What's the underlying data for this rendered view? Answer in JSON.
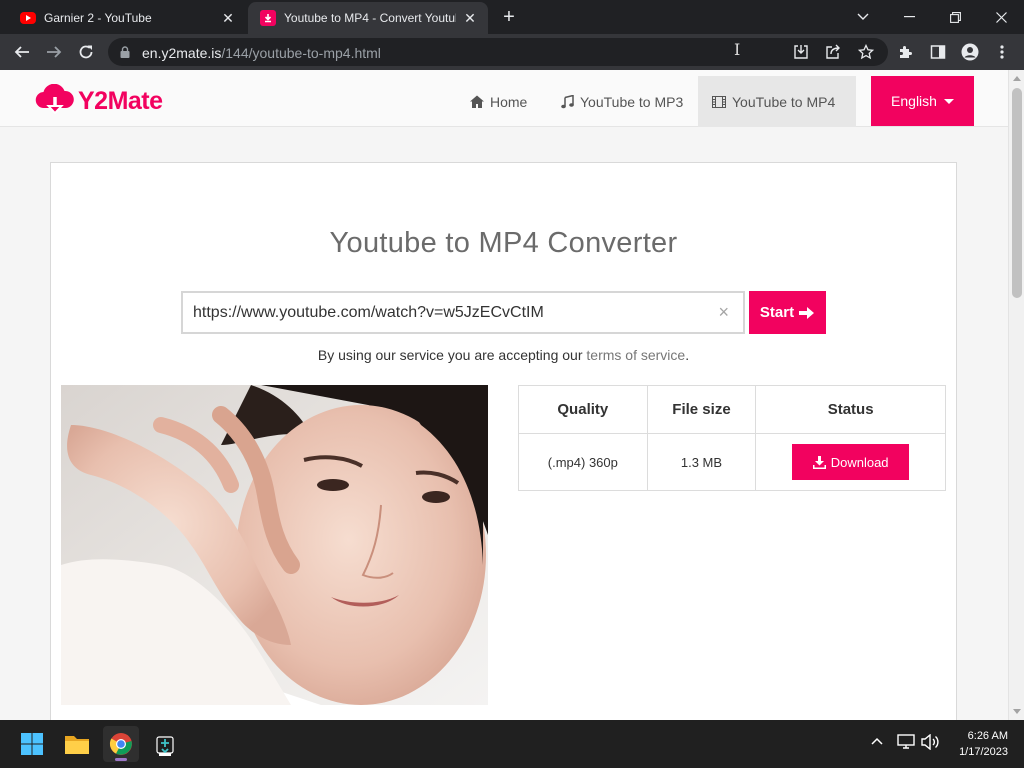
{
  "browser": {
    "tabs": [
      {
        "title": "Garnier 2 - YouTube",
        "active": false
      },
      {
        "title": "Youtube to MP4 - Convert Youtub",
        "active": true
      }
    ],
    "url": {
      "host": "en.y2mate.is",
      "path": "/144/youtube-to-mp4.html"
    }
  },
  "site": {
    "logo": "Y2Mate",
    "nav": [
      {
        "label": "Home",
        "icon": "home-icon",
        "active": false
      },
      {
        "label": "YouTube to MP3",
        "icon": "music-note-icon",
        "active": false
      },
      {
        "label": "YouTube to MP4",
        "icon": "film-icon",
        "active": true
      }
    ],
    "language": "English",
    "accent_color": "#f2025f"
  },
  "converter": {
    "title": "Youtube to MP4 Converter",
    "input_value": "https://www.youtube.com/watch?v=w5JzECvCtIM",
    "clear_glyph": "×",
    "start_label": "Start",
    "terms_prefix": "By using our service you are accepting our",
    "terms_link": "terms of service",
    "terms_suffix": "."
  },
  "results": {
    "headers": [
      "Quality",
      "File size",
      "Status"
    ],
    "rows": [
      {
        "quality": "(.mp4) 360p",
        "size": "1.3 MB",
        "action": "Download"
      }
    ]
  },
  "taskbar": {
    "time": "6:26 AM",
    "date": "1/17/2023"
  }
}
